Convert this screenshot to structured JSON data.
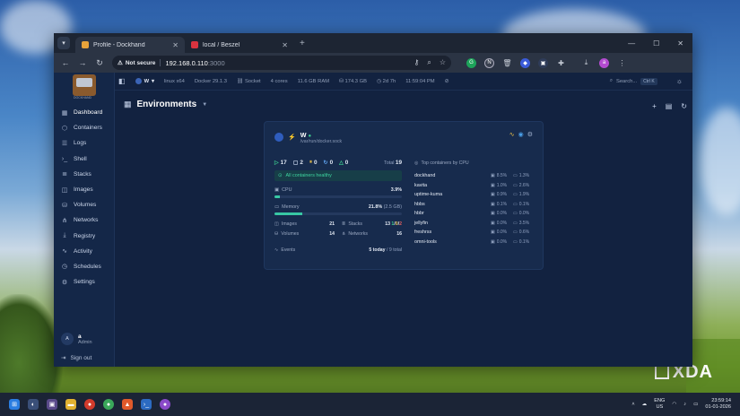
{
  "browser": {
    "tabs": [
      {
        "title": "Profile - Dockhand",
        "active": true,
        "favicon_color": "#e8a33a"
      },
      {
        "title": "local / Beszel",
        "active": false,
        "favicon_color": "#d9333f"
      }
    ],
    "security_label": "Not secure",
    "url_host": "192.168.0.110",
    "url_port": ":3000"
  },
  "sidebar": {
    "logo_text": "DOCKHAND",
    "items": [
      {
        "label": "Dashboard",
        "icon": "dashboard-icon",
        "glyph": "▦"
      },
      {
        "label": "Containers",
        "icon": "containers-icon",
        "glyph": "⬡"
      },
      {
        "label": "Logs",
        "icon": "logs-icon",
        "glyph": "☰"
      },
      {
        "label": "Shell",
        "icon": "shell-icon",
        "glyph": "›_"
      },
      {
        "label": "Stacks",
        "icon": "stacks-icon",
        "glyph": "≣"
      },
      {
        "label": "Images",
        "icon": "images-icon",
        "glyph": "◫"
      },
      {
        "label": "Volumes",
        "icon": "volumes-icon",
        "glyph": "⛁"
      },
      {
        "label": "Networks",
        "icon": "networks-icon",
        "glyph": "⋔"
      },
      {
        "label": "Registry",
        "icon": "registry-icon",
        "glyph": "⤓"
      },
      {
        "label": "Activity",
        "icon": "activity-icon",
        "glyph": "∿"
      },
      {
        "label": "Schedules",
        "icon": "schedules-icon",
        "glyph": "◷"
      },
      {
        "label": "Settings",
        "icon": "settings-icon",
        "glyph": "⚙"
      }
    ],
    "user": {
      "initial": "A",
      "name": "a",
      "role": "Admin"
    },
    "signout": "Sign out"
  },
  "topbar": {
    "env": "W",
    "os": "linux x64",
    "docker": "Docker 29.1.3",
    "socket": "Socket",
    "cores": "4 cores",
    "ram": "11.6 GB RAM",
    "disk": "174.3 GB",
    "uptime": "2d 7h",
    "time": "11:59:04 PM",
    "search_label": "Search...",
    "shortcut": "Ctrl K"
  },
  "page": {
    "title": "Environments"
  },
  "env_card": {
    "name": "W",
    "socket_path": "/var/run/docker.sock",
    "counts": {
      "running": "17",
      "paused": "2",
      "stopped_y": "0",
      "restarting": "0",
      "healthy": "0",
      "total_label": "Total",
      "total": "19"
    },
    "health_status": "All containers healthy",
    "cpu_label": "CPU",
    "cpu_value": "3.9%",
    "cpu_fraction": 0.039,
    "memory_label": "Memory",
    "memory_value": "21.8%",
    "memory_sub": "(2.5 GB)",
    "memory_fraction": 0.218,
    "images_label": "Images",
    "images_value": "21",
    "stacks_label": "Stacks",
    "stacks_total": "13",
    "stacks_running": "1",
    "stacks_partial": "0",
    "stacks_stopped": "2",
    "volumes_label": "Volumes",
    "volumes_value": "14",
    "networks_label": "Networks",
    "networks_value": "16",
    "events_label": "Events",
    "events_today": "5 today",
    "events_total": "/ 9 total",
    "top_title": "Top containers by CPU",
    "top_containers": [
      {
        "name": "dockhand",
        "cpu": "8.5%",
        "mem": "1.3%"
      },
      {
        "name": "kavita",
        "cpu": "1.0%",
        "mem": "2.6%"
      },
      {
        "name": "uptime-kuma",
        "cpu": "0.9%",
        "mem": "1.9%"
      },
      {
        "name": "hbbs",
        "cpu": "0.1%",
        "mem": "0.1%"
      },
      {
        "name": "hbbr",
        "cpu": "0.0%",
        "mem": "0.0%"
      },
      {
        "name": "jellyfin",
        "cpu": "0.0%",
        "mem": "3.5%"
      },
      {
        "name": "freshrss",
        "cpu": "0.0%",
        "mem": "0.6%"
      },
      {
        "name": "omni-tools",
        "cpu": "0.0%",
        "mem": "0.1%"
      }
    ]
  },
  "taskbar": {
    "lang_top": "ENG",
    "lang_bottom": "US",
    "time": "23:59:14",
    "date": "01-01-2026"
  },
  "watermark": "XDA"
}
